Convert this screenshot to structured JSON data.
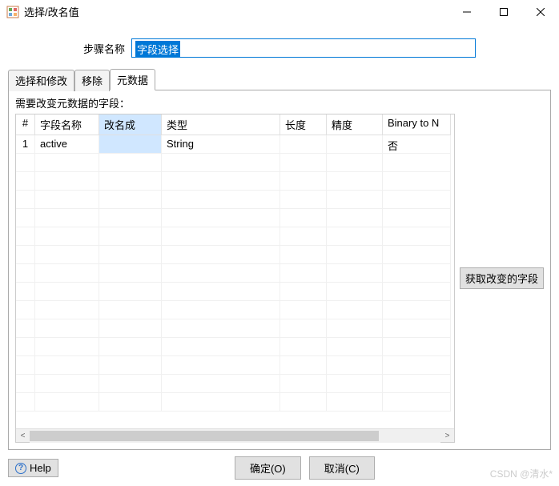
{
  "window": {
    "title": "选择/改名值"
  },
  "stepName": {
    "label": "步骤名称",
    "value": "字段选择"
  },
  "tabs": [
    {
      "label": "选择和修改",
      "active": false
    },
    {
      "label": "移除",
      "active": false
    },
    {
      "label": "元数据",
      "active": true
    }
  ],
  "panel": {
    "description": "需要改变元数据的字段：",
    "columns": {
      "num": "#",
      "fieldName": "字段名称",
      "renameTo": "改名成",
      "type": "类型",
      "length": "长度",
      "precision": "精度",
      "binaryToNormal": "Binary to N"
    },
    "rows": [
      {
        "num": "1",
        "fieldName": "active",
        "renameTo": "",
        "type": "String",
        "length": "",
        "precision": "",
        "binaryToNormal": "否"
      }
    ]
  },
  "sideButton": "获取改变的字段",
  "buttons": {
    "help": "Help",
    "ok": "确定(O)",
    "cancel": "取消(C)"
  },
  "watermark": "CSDN @清水*"
}
